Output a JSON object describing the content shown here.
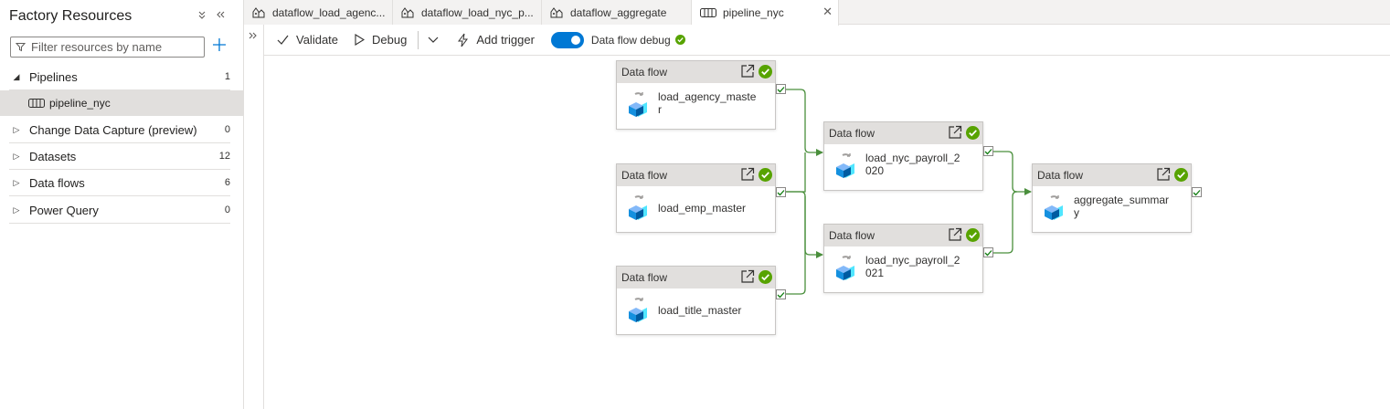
{
  "left_panel": {
    "title": "Factory Resources",
    "search_placeholder": "Filter resources by name",
    "tree": [
      {
        "label": "Pipelines",
        "count": "1",
        "expanded": true
      },
      {
        "label": "Change Data Capture (preview)",
        "count": "0",
        "expanded": false
      },
      {
        "label": "Datasets",
        "count": "12",
        "expanded": false
      },
      {
        "label": "Data flows",
        "count": "6",
        "expanded": false
      },
      {
        "label": "Power Query",
        "count": "0",
        "expanded": false
      }
    ],
    "pipeline_items": [
      {
        "label": "pipeline_nyc",
        "selected": true
      }
    ]
  },
  "tabs": [
    {
      "label": "dataflow_load_agenc...",
      "icon": "dataflow-icon",
      "active": false
    },
    {
      "label": "dataflow_load_nyc_p...",
      "icon": "dataflow-icon",
      "active": false
    },
    {
      "label": "dataflow_aggregate",
      "icon": "dataflow-icon",
      "active": false
    },
    {
      "label": "pipeline_nyc",
      "icon": "pipeline-icon",
      "active": true
    }
  ],
  "toolbar": {
    "validate": "Validate",
    "debug": "Debug",
    "add_trigger": "Add trigger",
    "dataflow_debug": "Data flow debug",
    "dataflow_debug_on": true
  },
  "activities": [
    {
      "type": "Data flow",
      "name": "load_agency_maste\nr",
      "status": "succeeded"
    },
    {
      "type": "Data flow",
      "name": "load_emp_master",
      "status": "succeeded"
    },
    {
      "type": "Data flow",
      "name": "load_title_master",
      "status": "succeeded"
    },
    {
      "type": "Data flow",
      "name": "load_nyc_payroll_2\n020",
      "status": "succeeded"
    },
    {
      "type": "Data flow",
      "name": "load_nyc_payroll_2\n021",
      "status": "succeeded"
    },
    {
      "type": "Data flow",
      "name": "aggregate_summar\ny",
      "status": "succeeded"
    }
  ],
  "colors": {
    "accent": "#0078d4",
    "success": "#57a300",
    "link": "#4a8f3c"
  }
}
